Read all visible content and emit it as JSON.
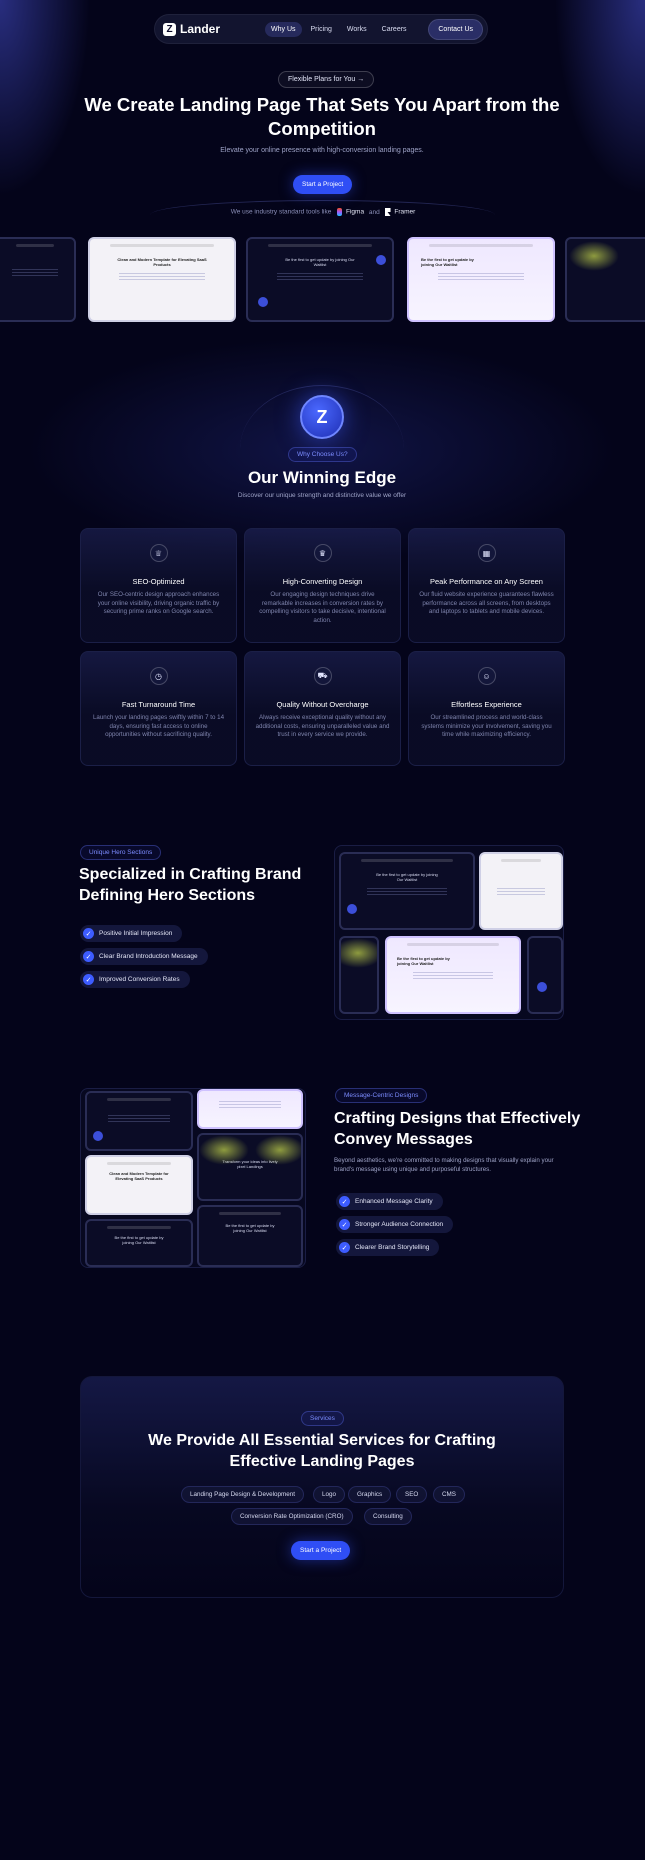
{
  "nav": {
    "logo_mark": "Z",
    "logo_text": "Lander",
    "links": [
      "Why Us",
      "Pricing",
      "Works",
      "Careers"
    ],
    "cta": "Contact Us"
  },
  "hero": {
    "pill": "Flexible Plans for You",
    "pill_arrow": "→",
    "title": "We Create Landing Page That Sets You Apart from the Competition",
    "subtitle": "Elevate your online presence with high-conversion landing pages.",
    "cta": "Start a Project",
    "tools_prefix": "We use industry standard tools like",
    "tool_1": "Figma",
    "tools_and": "and",
    "tool_2": "Framer"
  },
  "showcase": {
    "shot_light_title": "Clean and Modern Template for Elevating SaaS Products",
    "shot_dark_title": "Be the first to get update by joining Our Waitlist",
    "shot_lavender_title": "Be the first to get update by joining Our Waitlist"
  },
  "edge": {
    "icon": "Z",
    "tag": "Why Choose Us?",
    "title": "Our Winning Edge",
    "subtitle": "Discover our unique strength and distinctive value we offer",
    "cards": [
      {
        "icon": "trophy-icon",
        "glyph": "♕",
        "title": "SEO-Optimized",
        "text": "Our SEO-centric design approach enhances your online visibility, driving organic traffic by securing prime ranks on Google search."
      },
      {
        "icon": "crown-icon",
        "glyph": "♛",
        "title": "High-Converting Design",
        "text": "Our engaging design techniques drive remarkable increases in conversion rates by compelling visitors to take decisive, intentional action."
      },
      {
        "icon": "layout-icon",
        "glyph": "▦",
        "title": "Peak Performance on Any Screen",
        "text": "Our fluid website experience guarantees flawless performance across all screens, from desktops and laptops to tablets and mobile devices."
      },
      {
        "icon": "stopwatch-icon",
        "glyph": "◷",
        "title": "Fast Turnaround Time",
        "text": "Launch your landing pages swiftly within 7 to 14 days, ensuring fast access to online opportunities without sacrificing quality."
      },
      {
        "icon": "cart-icon",
        "glyph": "⛟",
        "title": "Quality Without Overcharge",
        "text": "Always receive exceptional quality without any additional costs, ensuring unparalleled value and trust in every service we provide."
      },
      {
        "icon": "smile-icon",
        "glyph": "☺",
        "title": "Effortless Experience",
        "text": "Our streamlined process and world-class systems minimize your involvement, saving you time while maximizing efficiency."
      }
    ]
  },
  "hero_sections": {
    "tag": "Unique Hero Sections",
    "title": "Specialized in Crafting Brand Defining Hero Sections",
    "items": [
      "Positive Initial Impression",
      "Clear Brand Introduction Message",
      "Improved Conversion Rates"
    ]
  },
  "message": {
    "tag": "Message-Centric Designs",
    "title": "Crafting Designs that Effectively Convey Messages",
    "subtitle": "Beyond aesthetics, we're committed to making designs that visually explain your brand's message using unique and purposeful structures.",
    "items": [
      "Enhanced Message Clarity",
      "Stronger Audience Connection",
      "Clearer Brand Storytelling"
    ],
    "collage_title": "Transform your ideas into lively pixel Landings"
  },
  "services": {
    "tag": "Services",
    "title": "We Provide All Essential Services for Crafting Effective Landing Pages",
    "chips": [
      "Landing Page Design & Development",
      "Logo",
      "Graphics",
      "SEO",
      "CMS",
      "Conversion Rate Optimization (CRO)",
      "Consulting"
    ],
    "cta": "Start a Project"
  },
  "colors": {
    "background": "#04041a",
    "accent": "#2f4ef5",
    "tag_text": "#7c8cff"
  }
}
